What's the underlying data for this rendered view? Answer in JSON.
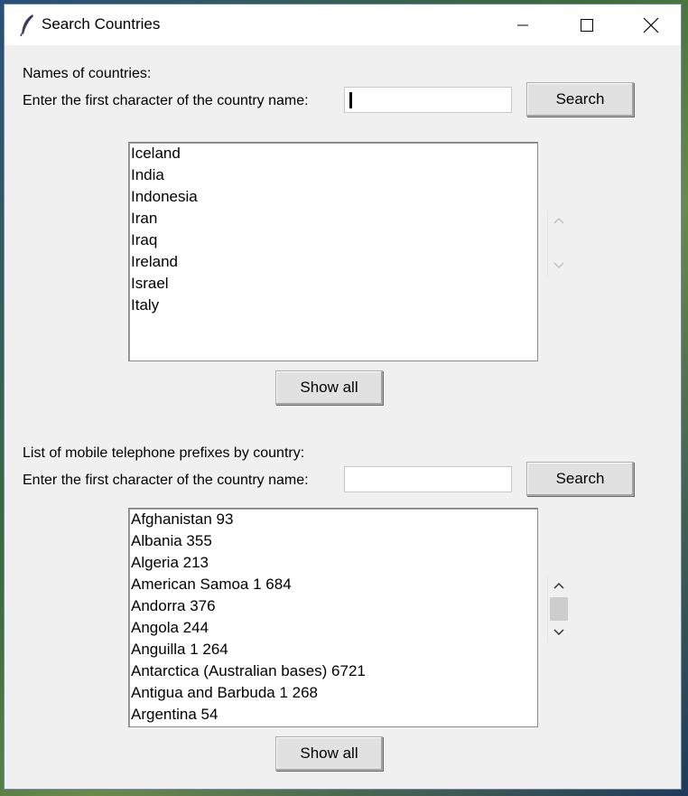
{
  "window": {
    "title": "Search Countries"
  },
  "section1": {
    "heading": "Names of countries:",
    "prompt": "Enter the first character of the country name:",
    "entry_value": "",
    "search_label": "Search",
    "show_all_label": "Show all",
    "items": [
      "Iceland",
      "India",
      "Indonesia",
      "Iran",
      "Iraq",
      "Ireland",
      "Israel",
      "Italy"
    ]
  },
  "section2": {
    "heading": "List of mobile telephone prefixes by country:",
    "prompt": "Enter the first character of the country name:",
    "entry_value": "",
    "search_label": "Search",
    "show_all_label": "Show all",
    "items": [
      "Afghanistan 93",
      "Albania 355",
      "Algeria 213",
      "American Samoa 1 684",
      "Andorra 376",
      "Angola 244",
      "Anguilla 1 264",
      "Antarctica (Australian bases) 6721",
      "Antigua and Barbuda 1 268",
      "Argentina 54"
    ]
  },
  "icons": {
    "app": "feather-icon",
    "minimize": "minimize-icon",
    "maximize": "maximize-icon",
    "close": "close-icon"
  }
}
